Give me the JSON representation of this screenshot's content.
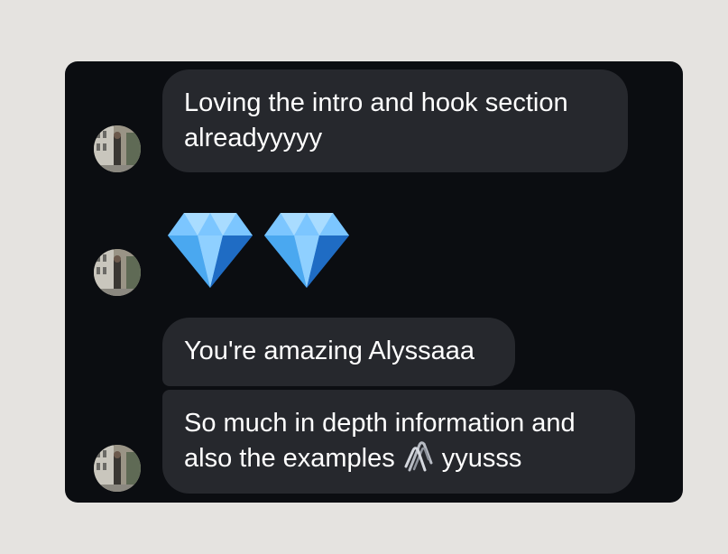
{
  "chat": {
    "messages": [
      {
        "lines": [
          "Loving the intro and hook section",
          "alreadyyyyy"
        ]
      },
      {
        "emoji": [
          "gem-icon",
          "gem-icon"
        ]
      },
      {
        "lines": [
          "You're amazing Alyssaaa"
        ]
      },
      {
        "line1": "So much in depth information and",
        "line2_before": "also the examples",
        "line2_icon": "paperclip-icon",
        "line2_after": "yyusss"
      }
    ]
  },
  "colors": {
    "page_background": "#e5e3e0",
    "panel_background": "#0b0d11",
    "bubble_background": "#26282d",
    "text": "#ffffff",
    "gem_blue": "#4aa8f0"
  }
}
